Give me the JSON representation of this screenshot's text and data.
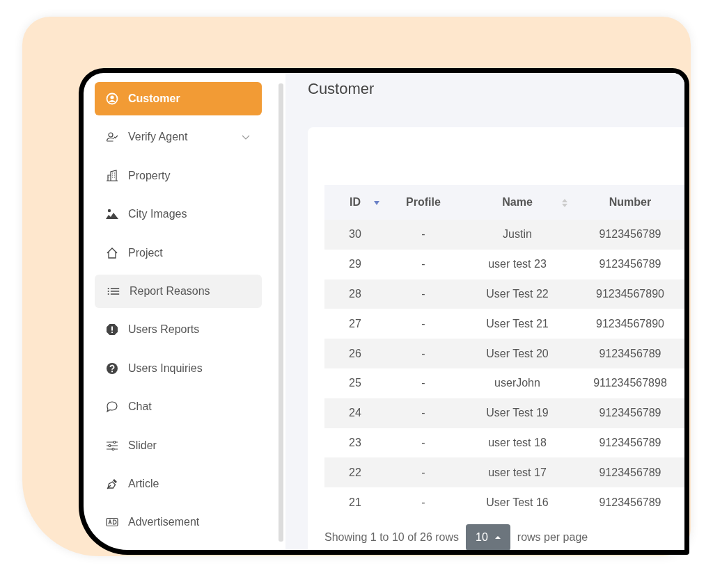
{
  "sidebar": {
    "items": [
      {
        "label": "Customer",
        "selected": true,
        "highlighted": false
      },
      {
        "label": "Verify Agent",
        "selected": false,
        "highlighted": false,
        "expanded": false
      },
      {
        "label": "Property",
        "selected": false,
        "highlighted": false
      },
      {
        "label": "City Images",
        "selected": false,
        "highlighted": false
      },
      {
        "label": "Project",
        "selected": false,
        "highlighted": false
      },
      {
        "label": "Report Reasons",
        "selected": false,
        "highlighted": true
      },
      {
        "label": "Users Reports",
        "selected": false,
        "highlighted": false
      },
      {
        "label": "Users Inquiries",
        "selected": false,
        "highlighted": false
      },
      {
        "label": "Chat",
        "selected": false,
        "highlighted": false
      },
      {
        "label": "Slider",
        "selected": false,
        "highlighted": false
      },
      {
        "label": "Article",
        "selected": false,
        "highlighted": false
      },
      {
        "label": "Advertisement",
        "selected": false,
        "highlighted": false
      }
    ]
  },
  "page": {
    "title": "Customer"
  },
  "table": {
    "columns": [
      {
        "label": "ID",
        "sortable": true,
        "sorted": true
      },
      {
        "label": "Profile",
        "sortable": false,
        "sorted": false
      },
      {
        "label": "Name",
        "sortable": true,
        "sorted": false
      },
      {
        "label": "Number",
        "sortable": false,
        "sorted": false
      }
    ],
    "rows": [
      [
        "30",
        "-",
        "Justin",
        "9123456789"
      ],
      [
        "29",
        "-",
        "user test 23",
        "9123456789"
      ],
      [
        "28",
        "-",
        "User Test 22",
        "91234567890"
      ],
      [
        "27",
        "-",
        "User Test 21",
        "91234567890"
      ],
      [
        "26",
        "-",
        "User Test 20",
        "9123456789"
      ],
      [
        "25",
        "-",
        "userJohn",
        "911234567898"
      ],
      [
        "24",
        "-",
        "User Test 19",
        "9123456789"
      ],
      [
        "23",
        "-",
        "user test 18",
        "9123456789"
      ],
      [
        "22",
        "-",
        "user test 17",
        "9123456789"
      ],
      [
        "21",
        "-",
        "User Test 16",
        "9123456789"
      ]
    ]
  },
  "pagination": {
    "summary": "Showing 1 to 10 of 26 rows",
    "page_size": "10",
    "suffix": "rows per page"
  }
}
